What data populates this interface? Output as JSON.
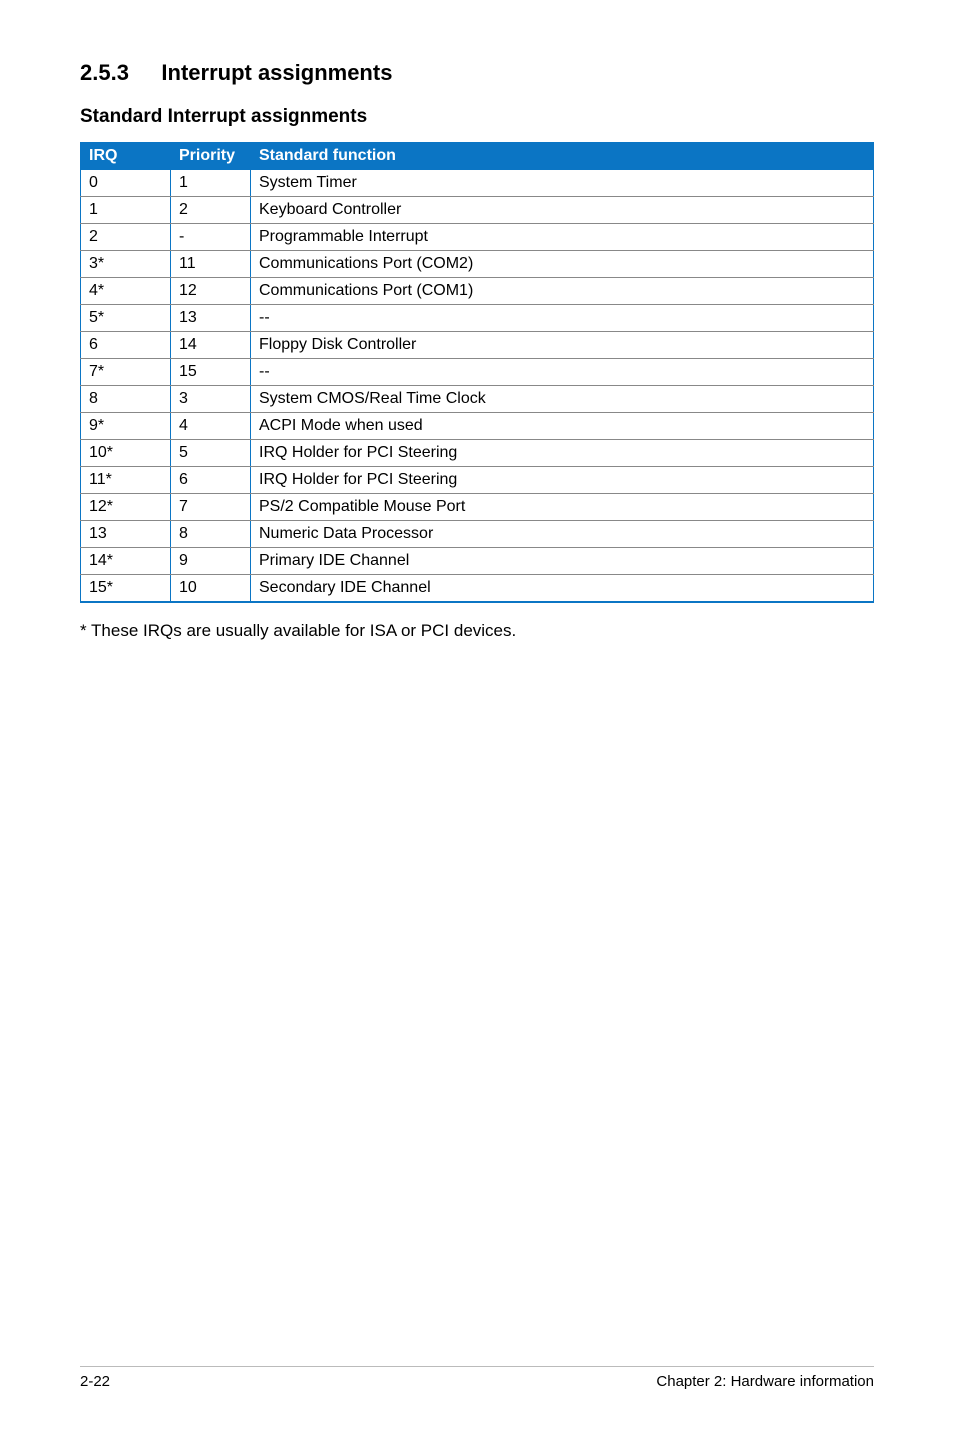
{
  "heading": {
    "number": "2.5.3",
    "title": "Interrupt assignments"
  },
  "subheading": "Standard Interrupt assignments",
  "table": {
    "headers": {
      "irq": "IRQ",
      "priority": "Priority",
      "func": "Standard function"
    },
    "rows": [
      {
        "irq": "0",
        "priority": "1",
        "func": "System Timer"
      },
      {
        "irq": "1",
        "priority": "2",
        "func": "Keyboard Controller"
      },
      {
        "irq": "2",
        "priority": "-",
        "func": "Programmable Interrupt"
      },
      {
        "irq": "3*",
        "priority": "11",
        "func": "Communications Port (COM2)"
      },
      {
        "irq": "4*",
        "priority": "12",
        "func": "Communications Port (COM1)"
      },
      {
        "irq": "5*",
        "priority": "13",
        "func": "--"
      },
      {
        "irq": "6",
        "priority": "14",
        "func": "Floppy Disk Controller"
      },
      {
        "irq": "7*",
        "priority": "15",
        "func": "--"
      },
      {
        "irq": "8",
        "priority": "3",
        "func": "System CMOS/Real Time Clock"
      },
      {
        "irq": "9*",
        "priority": "4",
        "func": "ACPI Mode when used"
      },
      {
        "irq": "10*",
        "priority": "5",
        "func": "IRQ Holder for PCI Steering"
      },
      {
        "irq": "11*",
        "priority": "6",
        "func": "IRQ Holder for PCI Steering"
      },
      {
        "irq": "12*",
        "priority": "7",
        "func": "PS/2 Compatible Mouse Port"
      },
      {
        "irq": "13",
        "priority": "8",
        "func": "Numeric Data Processor"
      },
      {
        "irq": "14*",
        "priority": "9",
        "func": "Primary IDE Channel"
      },
      {
        "irq": "15*",
        "priority": "10",
        "func": "Secondary IDE Channel"
      }
    ]
  },
  "footnote": "* These IRQs are usually available for ISA or PCI devices.",
  "footer": {
    "left": "2-22",
    "right": "Chapter 2: Hardware information"
  }
}
